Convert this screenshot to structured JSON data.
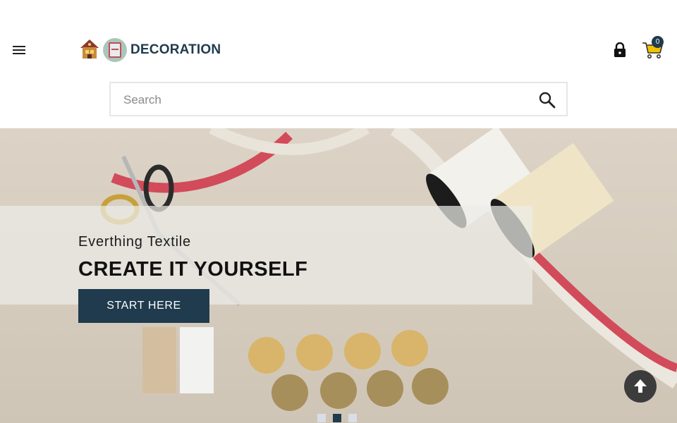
{
  "header": {
    "brand": "DECORATION",
    "cart_count": "0",
    "icons": [
      "menu-icon",
      "logo-icon",
      "lock-icon",
      "cart-icon"
    ]
  },
  "search": {
    "placeholder": "Search",
    "value": ""
  },
  "hero": {
    "subtitle": "Everthing Textile",
    "title": "CREATE IT YOURSELF",
    "cta_label": "START HERE",
    "slides_total": 3,
    "active_slide": 2
  },
  "colors": {
    "accent": "#1f3b4d",
    "logo_circle": "#a9c7b9",
    "back_to_top": "#3c3c3c"
  }
}
